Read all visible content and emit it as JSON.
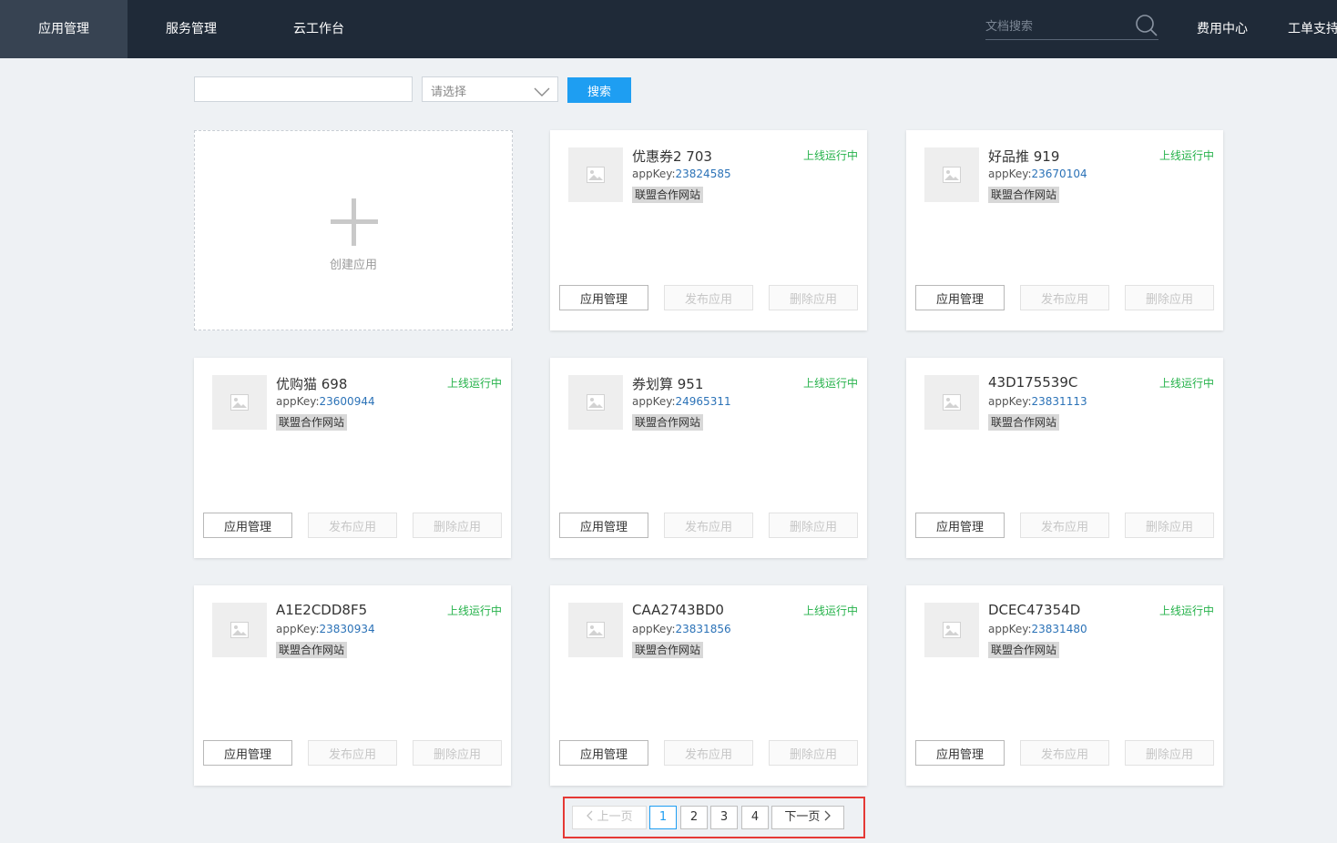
{
  "nav": {
    "items": [
      {
        "label": "应用管理",
        "active": true
      },
      {
        "label": "服务管理",
        "active": false
      },
      {
        "label": "云工作台",
        "active": false
      }
    ],
    "search_placeholder": "文档搜索",
    "billing_label": "费用中心",
    "ticket_label": "工单支持"
  },
  "filter": {
    "keyword_value": "",
    "select_placeholder": "请选择",
    "search_label": "搜索"
  },
  "create_card": {
    "label": "创建应用",
    "icon": "plus-icon"
  },
  "apps": [
    {
      "name": "优惠券2 703",
      "status": "上线运行中",
      "appkey_label": "appKey:",
      "appkey": "23824585",
      "tag": "联盟合作网站"
    },
    {
      "name": "好品推 919",
      "status": "上线运行中",
      "appkey_label": "appKey:",
      "appkey": "23670104",
      "tag": "联盟合作网站"
    },
    {
      "name": "优购猫 698",
      "status": "上线运行中",
      "appkey_label": "appKey:",
      "appkey": "23600944",
      "tag": "联盟合作网站"
    },
    {
      "name": "券划算 951",
      "status": "上线运行中",
      "appkey_label": "appKey:",
      "appkey": "24965311",
      "tag": "联盟合作网站"
    },
    {
      "name": "43D175539C",
      "status": "上线运行中",
      "appkey_label": "appKey:",
      "appkey": "23831113",
      "tag": "联盟合作网站"
    },
    {
      "name": "A1E2CDD8F5",
      "status": "上线运行中",
      "appkey_label": "appKey:",
      "appkey": "23830934",
      "tag": "联盟合作网站"
    },
    {
      "name": "CAA2743BD0",
      "status": "上线运行中",
      "appkey_label": "appKey:",
      "appkey": "23831856",
      "tag": "联盟合作网站"
    },
    {
      "name": "DCEC47354D",
      "status": "上线运行中",
      "appkey_label": "appKey:",
      "appkey": "23831480",
      "tag": "联盟合作网站"
    }
  ],
  "card_buttons": {
    "manage_label": "应用管理",
    "publish_label": "发布应用",
    "delete_label": "删除应用"
  },
  "pagination": {
    "prev_label": "上一页",
    "next_label": "下一页",
    "pages": [
      "1",
      "2",
      "3",
      "4"
    ],
    "current": "1"
  },
  "colors": {
    "topbar": "#1f2a38",
    "primary": "#1e9ef2",
    "status_green": "#25b24a",
    "highlight_red": "#e53935"
  }
}
